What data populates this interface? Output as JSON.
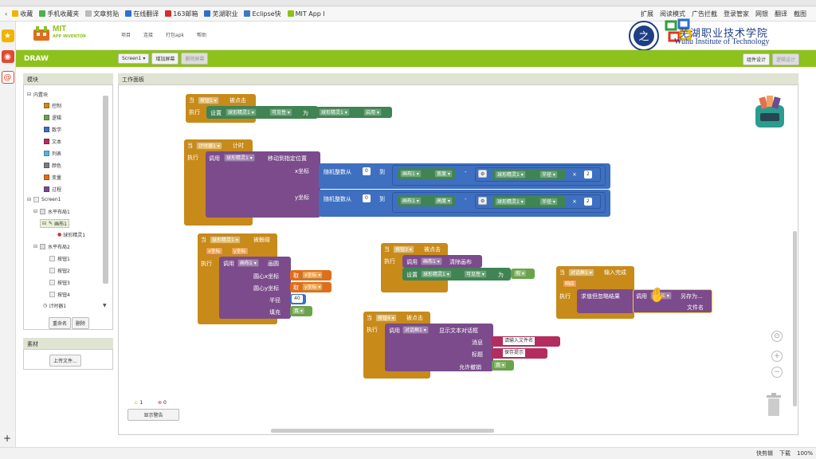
{
  "browser": {
    "bookmarks": [
      {
        "label": "收藏",
        "color": "#f0b400"
      },
      {
        "label": "手机收藏夹",
        "color": "#4caf50"
      },
      {
        "label": "文章剪贴",
        "color": "#bbbbbb"
      },
      {
        "label": "在线翻译",
        "color": "#2e6fd1"
      },
      {
        "label": "163邮箱",
        "color": "#d42d2d"
      },
      {
        "label": "芜湖职业",
        "color": "#2e6fd1"
      },
      {
        "label": "Eclipse快",
        "color": "#3d79c3"
      },
      {
        "label": "MIT App I",
        "color": "#8dc11c"
      }
    ],
    "bookmarks_right": [
      "扩展",
      "阅读模式",
      "广告拦截",
      "登录管家",
      "网银",
      "翻译",
      "截图"
    ],
    "status": {
      "quick_clip": "快剪辑",
      "download": "下载",
      "zoom": "100%"
    }
  },
  "app": {
    "logo_title": "MIT",
    "logo_subtitle": "APP INVENTOR",
    "menu": [
      "项目",
      "连接",
      "打包apk",
      "帮助"
    ],
    "school_cn": "芜湖职业技术学院",
    "school_en": "Wuhu Institute of Technology",
    "project_name": "DRAW",
    "screen_select": "Screen1",
    "add_screen": "增加屏幕",
    "remove_screen": "删除屏幕",
    "designer_btn": "组件设计",
    "blocks_btn": "逻辑设计"
  },
  "blocks_panel": {
    "title": "模块",
    "builtin": "内置块",
    "builtin_items": [
      {
        "label": "控制",
        "color": "#c88a19"
      },
      {
        "label": "逻辑",
        "color": "#69a44b"
      },
      {
        "label": "数学",
        "color": "#3f6fc0"
      },
      {
        "label": "文本",
        "color": "#b32d5e"
      },
      {
        "label": "列表",
        "color": "#5db2d3"
      },
      {
        "label": "颜色",
        "color": "#7d7d7d"
      },
      {
        "label": "变量",
        "color": "#e06d1c"
      },
      {
        "label": "过程",
        "color": "#7b4b8c"
      }
    ],
    "screen": "Screen1",
    "components": [
      "水平布局1",
      "画布1",
      "球形精灵1",
      "水平布局2",
      "按钮1",
      "按钮2",
      "按钮3",
      "按钮4",
      "计时器1"
    ],
    "rename": "重命名",
    "delete": "删除",
    "media_title": "素材",
    "upload": "上传文件..."
  },
  "workspace": {
    "title": "工作面板",
    "warnings_count": "1",
    "errors_count": "0",
    "show_warnings": "显示警告",
    "b1": {
      "when": "当",
      "comp": "按钮1",
      "event": "被点击",
      "do": "执行",
      "set": "设置",
      "target": "球形精灵1",
      "prop": "可见性",
      "to": "为",
      "value_comp": "球形精灵1",
      "value_prop": "启用"
    },
    "b2": {
      "when": "当",
      "comp": "计时器1",
      "event": "计时",
      "do": "执行",
      "call": "调用",
      "target": "球形精灵1",
      "method": "移动到指定位置",
      "x": "x坐标",
      "y": "y坐标",
      "rand": "随机整数从",
      "zero": "0",
      "to": "到",
      "canvas": "画布1",
      "width": "宽度",
      "height": "高度",
      "sprite": "球形精灵1",
      "radius": "半径",
      "times": "×",
      "two": "2",
      "minus": "-"
    },
    "b3": {
      "when": "当",
      "comp": "球形精灵1",
      "event": "被触碰",
      "px": "x坐标",
      "py": "y坐标",
      "do": "执行",
      "call": "调用",
      "canvas": "画布1",
      "method": "画圆",
      "cx": "圆心x坐标",
      "cy": "圆心y坐标",
      "r": "半径",
      "fill": "填充",
      "get": "取",
      "gx": "x坐标",
      "gy": "y坐标",
      "rv": "40",
      "fv": "真"
    },
    "b4": {
      "when": "当",
      "comp": "按钮3",
      "event": "被点击",
      "do": "执行",
      "call": "调用",
      "canvas": "画布1",
      "method": "清除画布",
      "set": "设置",
      "target": "球形精灵1",
      "prop": "可见性",
      "to": "为",
      "value": "假"
    },
    "b5": {
      "when": "当",
      "comp": "按钮4",
      "event": "被点击",
      "do": "执行",
      "call": "调用",
      "target": "对话框1",
      "method": "显示文本对话框",
      "msg": "消息",
      "msgv": "请输入文件名",
      "title": "标题",
      "titlev": "保存提示",
      "cancel": "允许撤销",
      "cancelv": "真"
    },
    "b6": {
      "when": "当",
      "comp": "对话框1",
      "event": "输入完成",
      "resp": "响应",
      "do": "执行",
      "ret": "求值但忽略结果",
      "call": "调用",
      "canvas": "画布1",
      "method": "另存为",
      "fname": "文件名"
    }
  }
}
